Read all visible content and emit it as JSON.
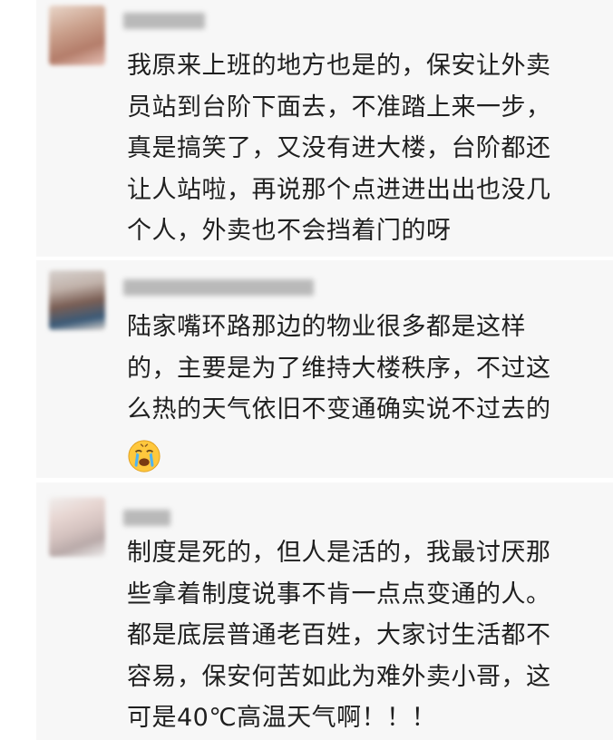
{
  "comments": [
    {
      "lines": [
        "我原来上班的地方也是的，保安让外卖",
        "员站到台阶下面去，不准踏上来一步，",
        "真是搞笑了，又没有进大楼，台阶都还",
        "让人站啦，再说那个点进进出出也没几",
        "个人，外卖也不会挡着门的呀"
      ]
    },
    {
      "lines": [
        "陆家嘴环路那边的物业很多都是这样",
        "的，主要是为了维持大楼秩序，不过这",
        "么热的天气依旧不变通确实说不过去的"
      ],
      "emoji": "crying-face-emoji"
    },
    {
      "lines": [
        "制度是死的，但人是活的，我最讨厌那",
        "些拿着制度说事不肯一点点变通的人。",
        "都是底层普通老百姓，大家讨生活都不",
        "容易，保安何苦如此为难外卖小哥，这",
        "可是40℃高温天气啊！！！"
      ]
    }
  ]
}
